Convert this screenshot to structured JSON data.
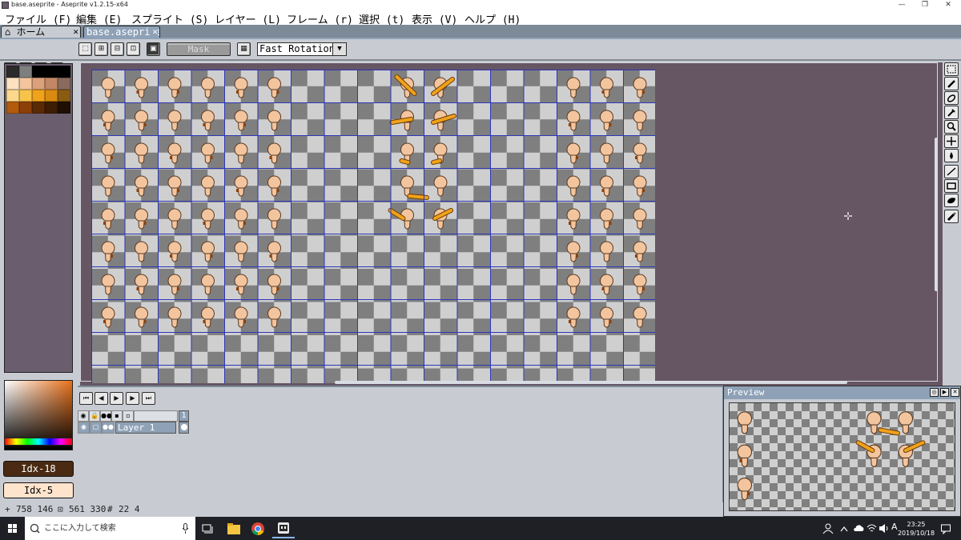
{
  "window": {
    "title": "base.aseprite - Aseprite v1.2.15-x64",
    "controls": [
      "—",
      "❐",
      "✕"
    ]
  },
  "menu": [
    "ファイル (F)",
    "編集 (E)",
    "スプライト (S)",
    "レイヤー (L)",
    "フレーム (r)",
    "選択 (t)",
    "表示 (V)",
    "ヘルプ (H)"
  ],
  "tabs": [
    {
      "label": "ホーム",
      "active": false
    },
    {
      "label": "base.aseprite",
      "active": true
    }
  ],
  "context_bar": {
    "mask_label": "Mask",
    "rotation_algorithm": "Fast Rotation"
  },
  "palette_panel": {
    "fg_index": "Idx-18",
    "bg_index": "Idx-5",
    "colors": [
      "#2b2b2b",
      "#7f7f7f",
      "#000000",
      "#000000",
      "#000000",
      "#fde2c2",
      "#f3c59e",
      "#dca07a",
      "#c28764",
      "#8a6a5c",
      "#fcd98a",
      "#f7c34b",
      "#f0a21b",
      "#d98a10",
      "#8a5c12",
      "#b45a0c",
      "#8c3f08",
      "#5a2a06",
      "#3d1d04",
      "#1f0f02"
    ]
  },
  "timeline": {
    "frame_number": "1",
    "layer_name": "Layer 1"
  },
  "preview": {
    "title": "Preview"
  },
  "status": {
    "cursor_pos": "758 146",
    "sprite_size": "561 330",
    "grid": "22 4"
  },
  "taskbar": {
    "search_placeholder": "ここに入力して検索",
    "time": "23:25",
    "date": "2019/10/18",
    "ime": "A"
  },
  "colors": {
    "ui_gray": "#c8ccd2",
    "workspace_bg": "#665663",
    "tab_active": "#8ea1b6",
    "grid_line": "#2d36b8",
    "skin": "#f3c59e",
    "wood": "#f0a21b"
  }
}
